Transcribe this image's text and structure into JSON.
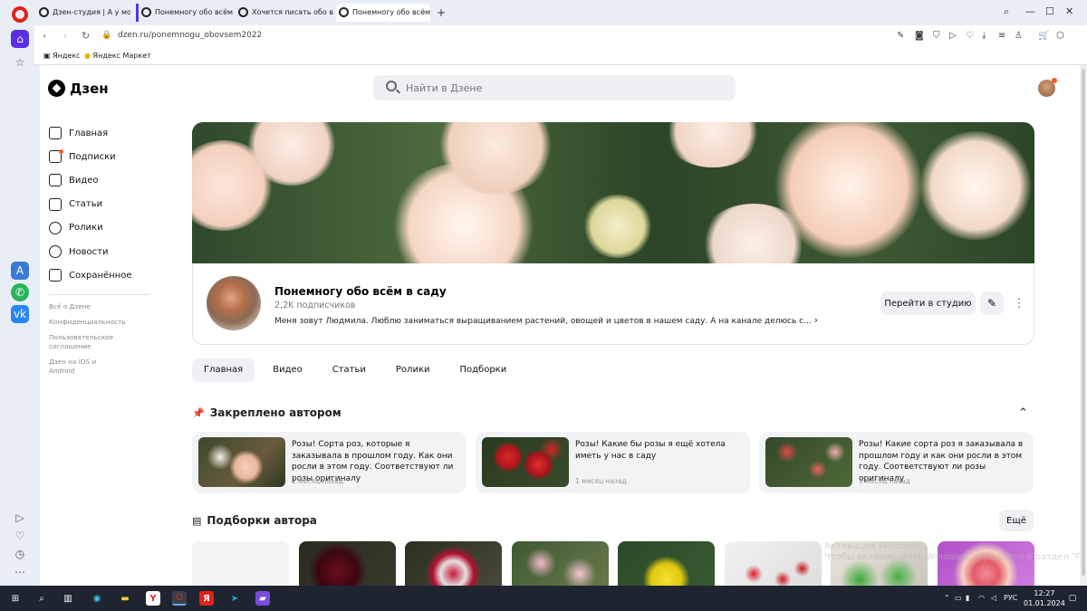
{
  "browser": {
    "tabs": [
      {
        "label": "Дзен-студия | А у моего"
      },
      {
        "label": "Понемногу обо всём в с"
      },
      {
        "label": "Хочется писать обо всё"
      },
      {
        "label": "Понемногу обо всём в с"
      }
    ],
    "url": "dzen.ru/ponemnogu_obovsem2022",
    "bookmarks": [
      "Яндекс",
      "Яндекс Маркет"
    ]
  },
  "header": {
    "logo": "Дзен",
    "search_placeholder": "Найти в Дзене"
  },
  "sidebar": {
    "items": [
      {
        "label": "Главная",
        "icon": "home-icon"
      },
      {
        "label": "Подписки",
        "icon": "subscriptions-icon"
      },
      {
        "label": "Видео",
        "icon": "video-icon"
      },
      {
        "label": "Статьи",
        "icon": "articles-icon"
      },
      {
        "label": "Ролики",
        "icon": "shorts-icon"
      },
      {
        "label": "Новости",
        "icon": "news-icon"
      },
      {
        "label": "Сохранённое",
        "icon": "bookmark-icon"
      }
    ],
    "footer": [
      "Всё о Дзене",
      "Конфиденциальность",
      "Пользовательское соглашение",
      "Дзен на iOS и Android"
    ]
  },
  "channel": {
    "name": "Понемногу обо всём в саду",
    "subscribers": "2,2K подписчиков",
    "description": "Меня зовут Людмила. Люблю заниматься выращиванием растений, овощей и цветов в нашем саду. А на канале делюсь с...",
    "studio_button": "Перейти в студию"
  },
  "channel_tabs": [
    "Главная",
    "Видео",
    "Статьи",
    "Ролики",
    "Подборки"
  ],
  "pinned": {
    "title": "Закреплено автором",
    "items": [
      {
        "title": "Розы! Сорта роз, которые я заказывала в прошлом году. Как они росли в этом году. Соответствуют ли розы оригиналу",
        "date": "1 месяц назад"
      },
      {
        "title": "Розы! Какие бы розы я ещё хотела иметь у нас в саду",
        "date": "1 месяц назад"
      },
      {
        "title": "Розы! Какие сорта роз я заказывала в прошлом году и как они росли в этом году. Соответствуют ли розы оригиналу",
        "date": "1 месяц назад"
      }
    ]
  },
  "collections": {
    "title": "Подборки автора",
    "more": "Ещё"
  },
  "watermark": {
    "line1": "Активация Windows",
    "line2": "Чтобы активировать Windows, перейдите в раздел \"Параметры\"."
  },
  "taskbar": {
    "lang": "РУС",
    "time": "12:27",
    "date": "01.01.2024"
  },
  "colors": {
    "accent": "#ff5b1e",
    "opera_red": "#e2231a",
    "opera_purple": "#5b2ee6"
  }
}
